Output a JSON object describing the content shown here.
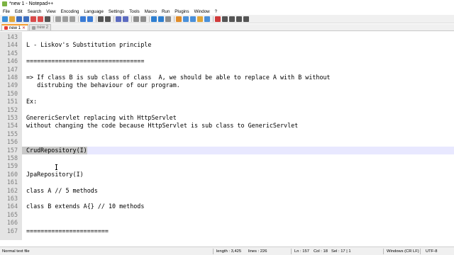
{
  "window": {
    "title": "*new 1 - Notepad++"
  },
  "menu": [
    "File",
    "Edit",
    "Search",
    "View",
    "Encoding",
    "Language",
    "Settings",
    "Tools",
    "Macro",
    "Run",
    "Plugins",
    "Window",
    "?"
  ],
  "toolbar": {
    "icons": [
      "new-file-icon",
      "open-file-icon",
      "save-icon",
      "save-all-icon",
      "close-icon",
      "close-all-icon",
      "print-icon",
      "cut-icon",
      "copy-icon",
      "paste-icon",
      "undo-icon",
      "redo-icon",
      "find-icon",
      "replace-icon",
      "zoom-in-icon",
      "zoom-out-icon",
      "sync-v-icon",
      "sync-h-icon",
      "word-wrap-icon",
      "all-chars-icon",
      "indent-guide-icon",
      "udl-icon",
      "doc-map-icon",
      "function-list-icon",
      "folder-workspace-icon",
      "monitor-icon",
      "record-macro-icon",
      "stop-macro-icon",
      "play-macro-icon",
      "run-macro-multiple-icon",
      "save-macro-icon"
    ],
    "colors": [
      "#3b8fd8",
      "#e0a63a",
      "#3e6fbf",
      "#3e6fbf",
      "#d84a4a",
      "#d84a4a",
      "#555555",
      "#9e9e9e",
      "#9e9e9e",
      "#9e9e9e",
      "#3a7bd5",
      "#3a7bd5",
      "#555555",
      "#555555",
      "#5c6bc0",
      "#5c6bc0",
      "#8d8d8d",
      "#8d8d8d",
      "#2f7fd0",
      "#2f7fd0",
      "#8d8d8d",
      "#e08c2a",
      "#4a90d9",
      "#4a90d9",
      "#e0a63a",
      "#4a90d9",
      "#d03a3a",
      "#555555",
      "#555555",
      "#555555",
      "#555555"
    ]
  },
  "tabs": [
    {
      "label": "new 1",
      "active": true
    },
    {
      "label": "new 2",
      "active": false
    }
  ],
  "editor": {
    "lines": [
      {
        "num": "143",
        "text": ""
      },
      {
        "num": "144",
        "text": "L - Liskov's Substitution principle"
      },
      {
        "num": "145",
        "text": ""
      },
      {
        "num": "146",
        "text": "================================="
      },
      {
        "num": "147",
        "text": ""
      },
      {
        "num": "148",
        "text": "=> If class B is sub class of class  A, we should be able to replace A with B without"
      },
      {
        "num": "149",
        "text": "   distrubing the behaviour of our program."
      },
      {
        "num": "150",
        "text": ""
      },
      {
        "num": "151",
        "text": "Ex:"
      },
      {
        "num": "152",
        "text": ""
      },
      {
        "num": "153",
        "text": "GnerericServlet replacing with HttpServlet"
      },
      {
        "num": "154",
        "text": "without changing the code because HttpServlet is sub class to GenericServlet"
      },
      {
        "num": "155",
        "text": ""
      },
      {
        "num": "156",
        "text": ""
      },
      {
        "num": "157",
        "text": "CrudRepository(I)"
      },
      {
        "num": "158",
        "text": ""
      },
      {
        "num": "159",
        "text": ""
      },
      {
        "num": "160",
        "text": "JpaRepository(I)"
      },
      {
        "num": "161",
        "text": ""
      },
      {
        "num": "162",
        "text": "class A // 5 methods"
      },
      {
        "num": "163",
        "text": ""
      },
      {
        "num": "164",
        "text": "class B extends A{} // 10 methods"
      },
      {
        "num": "165",
        "text": ""
      },
      {
        "num": "166",
        "text": ""
      },
      {
        "num": "167",
        "text": "======================="
      }
    ]
  },
  "status": {
    "filetype": "Normal text file",
    "length": "length : 3,425",
    "lines": "lines : 226",
    "ln": "Ln : 157",
    "col": "Col : 18",
    "sel": "Sel : 17 | 1",
    "eol": "Windows (CR LF)",
    "encoding": "UTF-8"
  }
}
